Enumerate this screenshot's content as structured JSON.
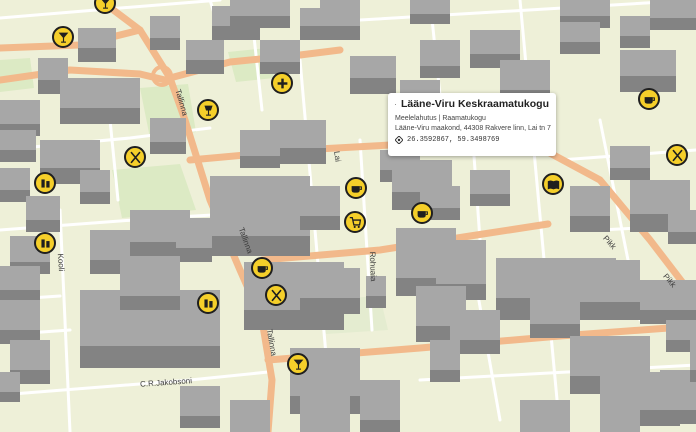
{
  "map": {
    "colors": {
      "background": "#eef0d8",
      "park": "#dceac4",
      "main_road": "#f2b98b",
      "minor_road": "#ffffff",
      "building_top": "#a7a7a7",
      "building_side": "#838383",
      "poi_fill": "#f5cf2a",
      "poi_border": "#1f1f1f"
    },
    "streets": [
      {
        "label": "Tallinna"
      },
      {
        "label": "Tallinna"
      },
      {
        "label": "Tallinna"
      },
      {
        "label": "Rohuaia"
      },
      {
        "label": "Kooli"
      },
      {
        "label": "C.R.Jakobsoni"
      },
      {
        "label": "Pikk"
      },
      {
        "label": "Pikk"
      },
      {
        "label": "Lai"
      }
    ],
    "pois": [
      {
        "type": "cocktail-icon"
      },
      {
        "type": "cocktail-icon"
      },
      {
        "type": "plus-icon"
      },
      {
        "type": "drink-icon"
      },
      {
        "type": "coffee-icon"
      },
      {
        "type": "coffee-icon"
      },
      {
        "type": "coffee-icon"
      },
      {
        "type": "restaurant-icon"
      },
      {
        "type": "restaurant-icon"
      },
      {
        "type": "restaurant-icon"
      },
      {
        "type": "bar-icon"
      },
      {
        "type": "bar-icon"
      },
      {
        "type": "book-icon"
      },
      {
        "type": "cart-icon"
      },
      {
        "type": "coffee-icon"
      },
      {
        "type": "bar-icon"
      },
      {
        "type": "cocktail-icon"
      }
    ]
  },
  "popup": {
    "title": "Lääne-Viru Keskraamatukogu",
    "category": "Meelelahutus | Raamatukogu",
    "address": "Lääne-Viru maakond, 44308 Rakvere linn, Lai tn 7",
    "coordinates": "26.3592867, 59.3498769",
    "icon": "book-icon",
    "coord_icon": "location-icon"
  }
}
